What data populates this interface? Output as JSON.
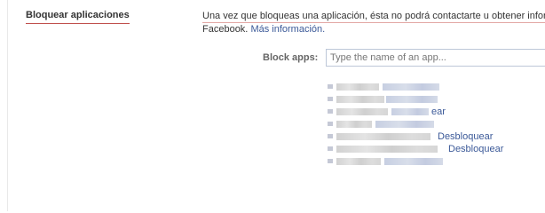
{
  "section": {
    "title": "Bloquear aplicaciones",
    "description_line1": "Una vez que bloqueas una aplicación, ésta no podrá contactarte u obtener inform",
    "description_line2_prefix": "Facebook.",
    "more_info_link": "Más información."
  },
  "block_apps": {
    "label": "Block apps:",
    "input_value": "",
    "placeholder": "Type the name of an app..."
  },
  "blocked_apps": {
    "items": [
      {
        "name": "",
        "unblock_visible_text": ""
      },
      {
        "name": "",
        "unblock_visible_text": ""
      },
      {
        "name": "",
        "unblock_visible_text": "ear"
      },
      {
        "name": "",
        "unblock_visible_text": ""
      },
      {
        "name": "",
        "unblock_visible_text": "Desbloquear"
      },
      {
        "name": "",
        "unblock_visible_text": "Desbloquear"
      },
      {
        "name": "",
        "unblock_visible_text": ""
      }
    ]
  },
  "colors": {
    "link": "#3b5998",
    "text": "#333333",
    "label": "#666666",
    "input_border": "#bdc7d8",
    "title_underline": "#c0504d"
  }
}
